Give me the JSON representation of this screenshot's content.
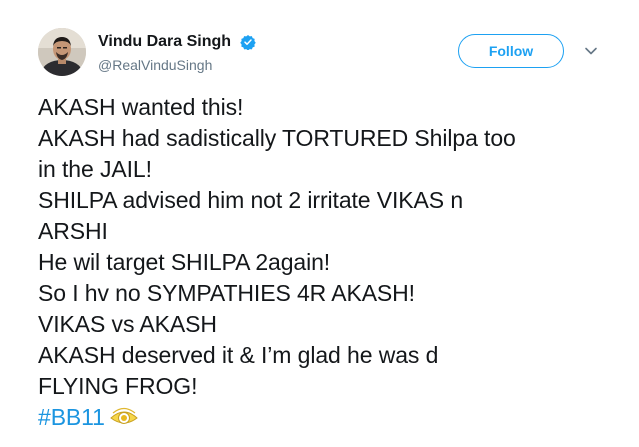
{
  "author": {
    "display_name": "Vindu Dara Singh",
    "handle": "@RealVinduSingh",
    "verified": true,
    "avatar_icon": "profile-photo"
  },
  "actions": {
    "follow_label": "Follow",
    "menu_icon": "chevron-down-icon"
  },
  "tweet": {
    "lines": [
      "AKASH wanted this!",
      "AKASH had sadistically  TORTURED Shilpa too",
      "in the JAIL!",
      "SHILPA advised him not 2 irritate VIKAS n",
      "ARSHI",
      "He wil target SHILPA 2again!",
      "So I hv no SYMPATHIES 4R AKASH!",
      "VIKAS vs AKASH",
      "AKASH deserved it & I’m glad he was d",
      "FLYING FROG!"
    ],
    "hashtag": "#BB11",
    "hashtag_icon": "bigg-boss-eye-icon"
  },
  "colors": {
    "accent": "#1da1f2",
    "link": "#1b95e0",
    "text": "#14171a",
    "secondary": "#657786"
  }
}
